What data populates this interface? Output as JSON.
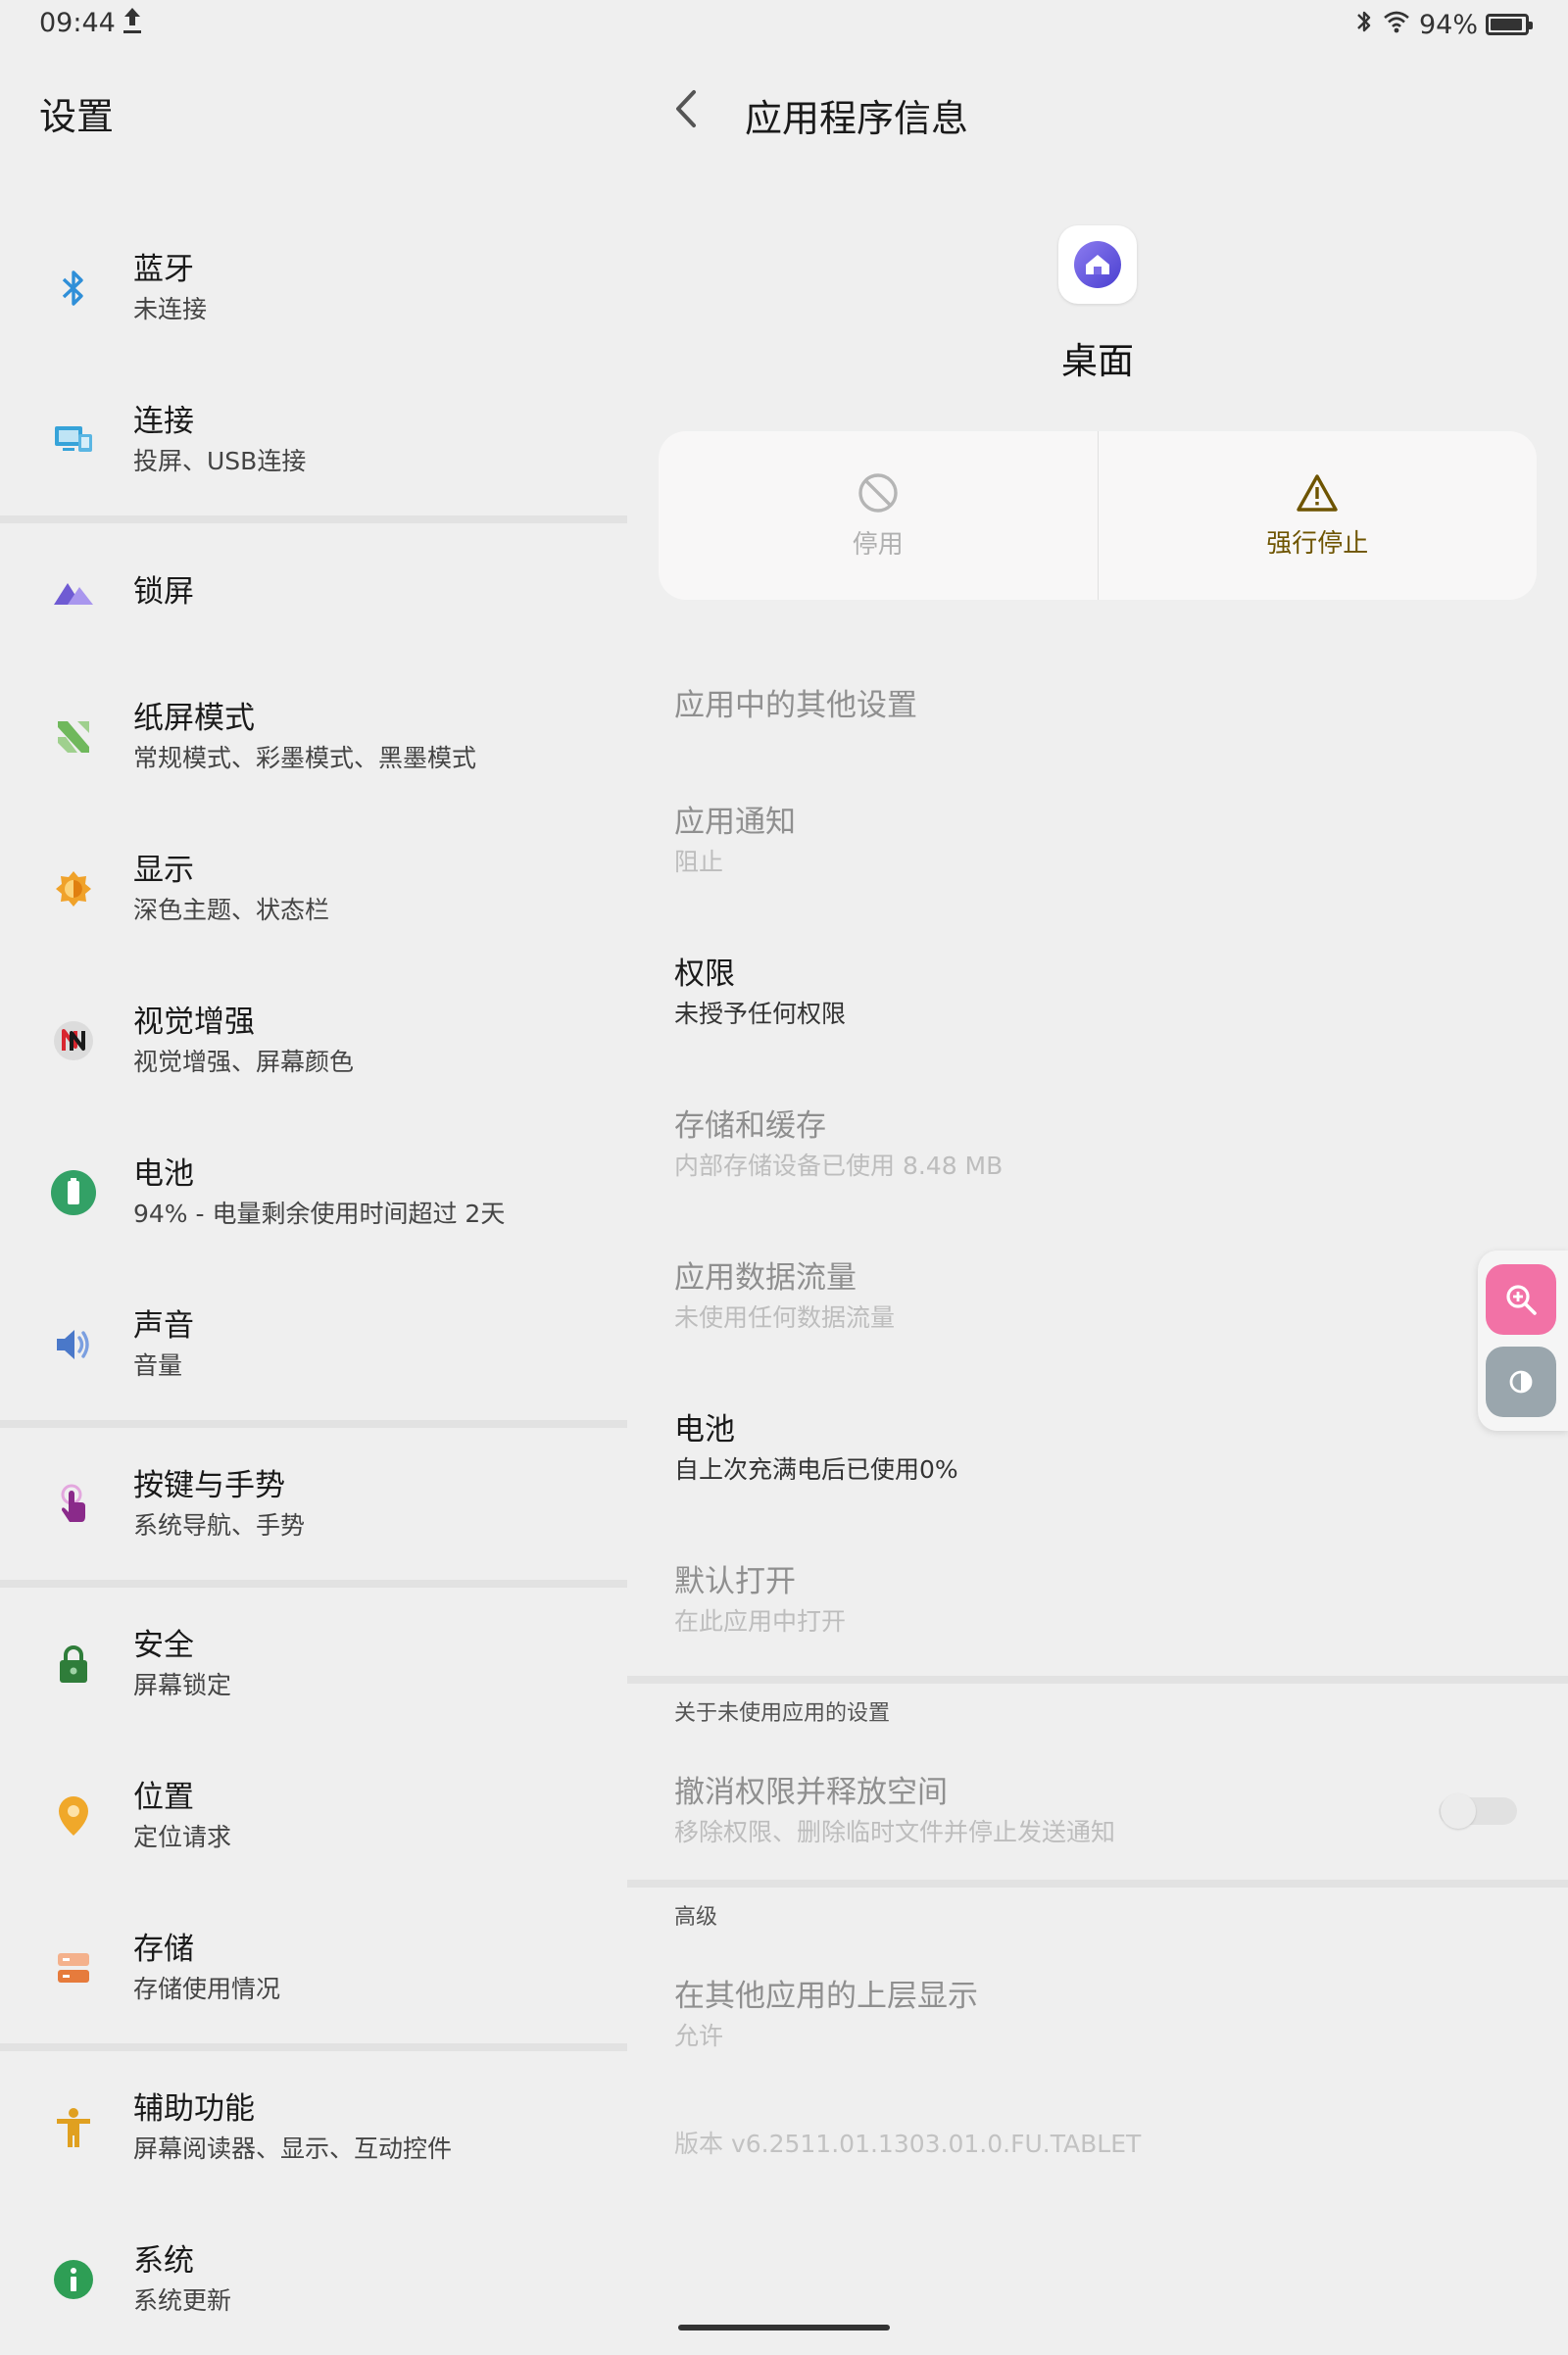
{
  "status_bar": {
    "time": "09:44",
    "battery_text": "94%",
    "battery_level": 0.94
  },
  "settings": {
    "title": "设置",
    "items": [
      {
        "title": "蓝牙",
        "subtitle": "未连接",
        "icon": "bluetooth-icon"
      },
      {
        "title": "连接",
        "subtitle": "投屏、USB连接",
        "icon": "connection-icon"
      },
      {
        "title": "锁屏",
        "subtitle": "",
        "icon": "lockscreen-icon"
      },
      {
        "title": "纸屏模式",
        "subtitle": "常规模式、彩墨模式、黑墨模式",
        "icon": "paper-mode-icon"
      },
      {
        "title": "显示",
        "subtitle": "深色主题、状态栏",
        "icon": "display-icon"
      },
      {
        "title": "视觉增强",
        "subtitle": "视觉增强、屏幕颜色",
        "icon": "visual-enhance-icon"
      },
      {
        "title": "电池",
        "subtitle": "94% - 电量剩余使用时间超过 2天",
        "icon": "battery-icon"
      },
      {
        "title": "声音",
        "subtitle": "音量",
        "icon": "sound-icon"
      },
      {
        "title": "按键与手势",
        "subtitle": "系统导航、手势",
        "icon": "gesture-icon"
      },
      {
        "title": "安全",
        "subtitle": "屏幕锁定",
        "icon": "security-icon"
      },
      {
        "title": "位置",
        "subtitle": "定位请求",
        "icon": "location-icon"
      },
      {
        "title": "存储",
        "subtitle": "存储使用情况",
        "icon": "storage-icon"
      },
      {
        "title": "辅助功能",
        "subtitle": "屏幕阅读器、显示、互动控件",
        "icon": "accessibility-icon"
      },
      {
        "title": "系统",
        "subtitle": "系统更新",
        "icon": "system-info-icon"
      }
    ]
  },
  "app_info": {
    "title": "应用程序信息",
    "app_name": "桌面",
    "actions": {
      "disable": "停用",
      "force_stop": "强行停止"
    },
    "items": [
      {
        "title": "应用中的其他设置",
        "subtitle": ""
      },
      {
        "title": "应用通知",
        "subtitle": "阻止"
      },
      {
        "title": "权限",
        "subtitle": "未授予任何权限"
      },
      {
        "title": "存储和缓存",
        "subtitle": "内部存储设备已使用 8.48 MB"
      },
      {
        "title": "应用数据流量",
        "subtitle": "未使用任何数据流量"
      },
      {
        "title": "电池",
        "subtitle": "自上次充满电后已使用0%"
      },
      {
        "title": "默认打开",
        "subtitle": "在此应用中打开"
      }
    ],
    "unused_section": {
      "header": "关于未使用应用的设置",
      "title": "撤消权限并释放空间",
      "subtitle": "移除权限、删除临时文件并停止发送通知",
      "toggle_on": false
    },
    "advanced_section": {
      "header": "高级",
      "title": "在其他应用的上层显示",
      "subtitle": "允许"
    },
    "version": "版本 v6.2511.01.1303.01.0.FU.TABLET"
  }
}
